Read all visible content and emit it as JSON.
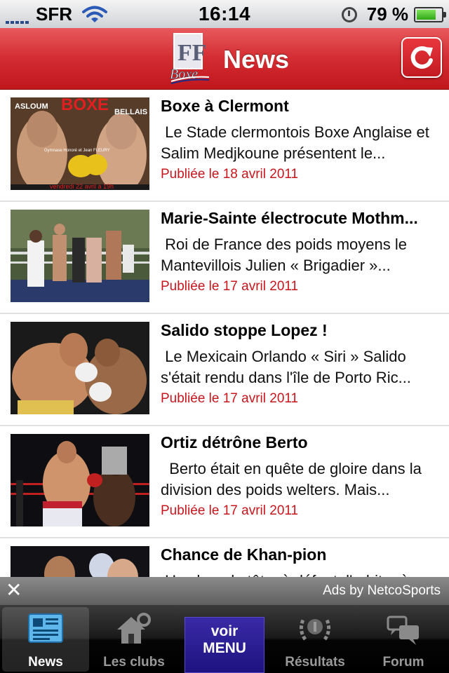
{
  "status_bar": {
    "carrier": "SFR",
    "time": "16:14",
    "battery": "79 %"
  },
  "header": {
    "title": "News",
    "logo_text": "FF Boxe"
  },
  "news": [
    {
      "title": "Boxe à Clermont",
      "summary": " Le Stade clermontois Boxe Anglaise et Salim Medjkoune présentent le...",
      "date": "Publiée le 18 avril 2011",
      "thumb_text": {
        "headline": "BOXE",
        "left_name": "ASLOUM",
        "right_name": "BELLAIS",
        "venue": "Gymnase Honoré et Jean FLEURY",
        "footer": "vendredi 22 avril à 19h"
      }
    },
    {
      "title": "Marie-Sainte électrocute Mothm...",
      "summary": " Roi de France des poids moyens le Mantevillois Julien « Brigadier »...",
      "date": "Publiée le 17 avril 2011"
    },
    {
      "title": "Salido stoppe Lopez !",
      "summary": " Le Mexicain Orlando « Siri » Salido s'était rendu dans l'île de Porto Ric...",
      "date": "Publiée le 17 avril 2011"
    },
    {
      "title": "Ortiz détrône Berto",
      "summary": "  Berto était en quête de gloire dans la division des poids welters. Mais...",
      "date": "Publiée le 17 avril 2011"
    },
    {
      "title": "Chance de Khan-pion",
      "summary": " Un choc de tête, à défaut, l'arbitre à...",
      "date": ""
    }
  ],
  "ad": {
    "close": "✕",
    "text": "Ads by NetcoSports"
  },
  "tabs": {
    "news": "News",
    "clubs": "Les clubs",
    "menu_line1": "voir",
    "menu_line2": "MENU",
    "results": "Résultats",
    "forum": "Forum"
  },
  "colors": {
    "header_red": "#d32c31",
    "date_red": "#c8161d",
    "menu_blue": "#2a1c93"
  }
}
